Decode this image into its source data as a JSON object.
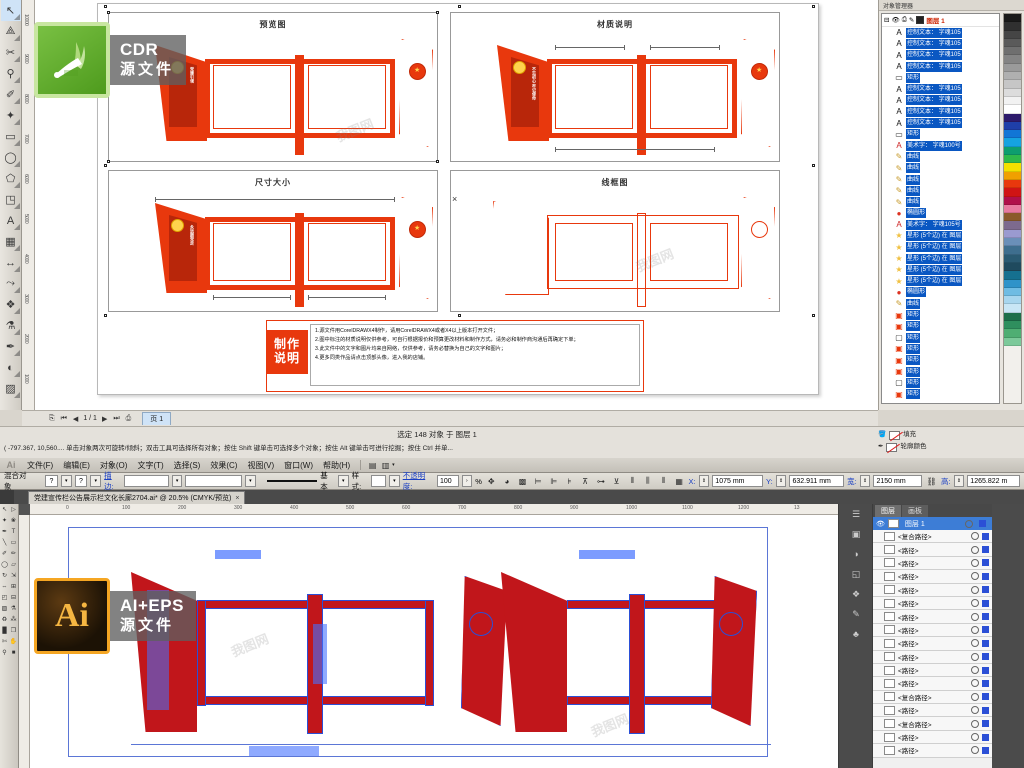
{
  "overlays": [
    {
      "id": "cdr",
      "icon": "coreldraw-icon",
      "line1": "CDR",
      "line2": "源文件"
    },
    {
      "id": "ai",
      "icon": "illustrator-icon",
      "line1": "AI+EPS",
      "line2": "源文件"
    }
  ],
  "watermark": {
    "text": "我图网"
  },
  "cdr": {
    "toolbox": [
      {
        "name": "pick-tool",
        "glyph": "↖"
      },
      {
        "name": "shape-tool",
        "glyph": "⟁"
      },
      {
        "name": "crop-tool",
        "glyph": "✂"
      },
      {
        "name": "zoom-tool",
        "glyph": "⚲"
      },
      {
        "name": "freehand-tool",
        "glyph": "✐"
      },
      {
        "name": "smart-fill-tool",
        "glyph": "✦"
      },
      {
        "name": "rectangle-tool",
        "glyph": "▭"
      },
      {
        "name": "ellipse-tool",
        "glyph": "◯"
      },
      {
        "name": "polygon-tool",
        "glyph": "⬠"
      },
      {
        "name": "basic-shapes-tool",
        "glyph": "◳"
      },
      {
        "name": "text-tool",
        "glyph": "A"
      },
      {
        "name": "table-tool",
        "glyph": "▦"
      },
      {
        "name": "dimension-tool",
        "glyph": "↔"
      },
      {
        "name": "connector-tool",
        "glyph": "⤳"
      },
      {
        "name": "blend-tool",
        "glyph": "❖"
      },
      {
        "name": "color-eyedropper-tool",
        "glyph": "⚗"
      },
      {
        "name": "outline-tool",
        "glyph": "✒"
      },
      {
        "name": "fill-tool",
        "glyph": "◐"
      },
      {
        "name": "interactive-fill-tool",
        "glyph": "▨"
      }
    ],
    "ruler_v": [
      "10000",
      "9000",
      "8000",
      "7000",
      "6000",
      "5000",
      "4000",
      "3000",
      "2000",
      "1000"
    ],
    "panels": [
      {
        "name": "preview-panel",
        "title": "预览图"
      },
      {
        "name": "material-panel",
        "title": "材质说明"
      },
      {
        "name": "size-panel",
        "title": "尺寸大小"
      },
      {
        "name": "wireframe-panel",
        "title": "线框图"
      }
    ],
    "board_vtexts": [
      "党建引领",
      "不忘初心 牢记使命",
      "永远跟党走"
    ],
    "instructions": {
      "badge_line1": "制作",
      "badge_line2": "说明",
      "items": [
        "1.源文件用CorelDRAWX4制作，请用CorelDRAWX4或者X4以上版本打开文件；",
        "2.图中标注的材质说明仅供参考，可自行根据报价和预算更改材料和制作方式，请务必和制作商沟通后再确定下单；",
        "3.此文件中的文字和图片均来自网络，仅供参考，请务必替换为自己的文字和图片；",
        "4.更多同类作品请点击顶部头像，进入我的店铺。"
      ]
    },
    "docker": {
      "tabs": [
        "对象管理器"
      ],
      "layer_name": "图层 1",
      "rows": [
        {
          "icon": "text-icon",
          "label": "控制文本： 字魂105"
        },
        {
          "icon": "text-icon",
          "label": "控制文本： 字魂105"
        },
        {
          "icon": "text-icon",
          "label": "控制文本： 字魂105"
        },
        {
          "icon": "text-icon",
          "label": "控制文本： 字魂105"
        },
        {
          "icon": "rect-icon",
          "label": "矩形"
        },
        {
          "icon": "text-icon",
          "label": "控制文本： 字魂105"
        },
        {
          "icon": "text-icon",
          "label": "控制文本： 字魂105"
        },
        {
          "icon": "text-icon",
          "label": "控制文本： 字魂105"
        },
        {
          "icon": "text-icon",
          "label": "控制文本： 字魂105"
        },
        {
          "icon": "rect-icon",
          "label": "矩形"
        },
        {
          "icon": "artistic-text-icon",
          "label": "美术字： 字魂100号"
        },
        {
          "icon": "curve-icon",
          "label": "曲线"
        },
        {
          "icon": "curve-icon",
          "label": "曲线"
        },
        {
          "icon": "curve-icon",
          "label": "曲线"
        },
        {
          "icon": "curve-icon",
          "label": "曲线"
        },
        {
          "icon": "curve-icon",
          "label": "曲线"
        },
        {
          "icon": "ellipse-icon",
          "label": "椭圆形"
        },
        {
          "icon": "artistic-text-icon",
          "label": "美术字： 字魂105号"
        },
        {
          "icon": "star-icon",
          "label": "星形 (5个边) 在 图层"
        },
        {
          "icon": "star-icon",
          "label": "星形 (5个边) 在 图层"
        },
        {
          "icon": "star-icon",
          "label": "星形 (5个边) 在 图层"
        },
        {
          "icon": "star-icon",
          "label": "星形 (5个边) 在 图层"
        },
        {
          "icon": "star-icon",
          "label": "星形 (5个边) 在 图层"
        },
        {
          "icon": "ellipse-icon",
          "label": "椭圆形"
        },
        {
          "icon": "curve-icon",
          "label": "曲线"
        },
        {
          "icon": "rect-red-icon",
          "label": "矩形"
        },
        {
          "icon": "rect-red-icon",
          "label": "矩形"
        },
        {
          "icon": "rect-white-icon",
          "label": "矩形"
        },
        {
          "icon": "rect-red-icon",
          "label": "矩形"
        },
        {
          "icon": "rect-red-icon",
          "label": "矩形"
        },
        {
          "icon": "rect-red-icon",
          "label": "矩形"
        },
        {
          "icon": "rect-white-icon",
          "label": "矩形"
        },
        {
          "icon": "rect-red-icon",
          "label": "矩形"
        }
      ]
    },
    "palette_colors": [
      "#1a1a1a",
      "#303030",
      "#454545",
      "#5a5a5a",
      "#6f6f6f",
      "#848484",
      "#9a9a9a",
      "#b0b0b0",
      "#c6c6c6",
      "#dcdcdc",
      "#f2f2f2",
      "#ffffff",
      "#2d1b6b",
      "#1f3fa8",
      "#1176d6",
      "#15a3e0",
      "#0e9e6e",
      "#2fb84b",
      "#f3e000",
      "#f0a000",
      "#e8380d",
      "#d01414",
      "#b0104a",
      "#e87aa0",
      "#8b5a2b",
      "#7d6a8e",
      "#9a9ad0",
      "#6a8fb8",
      "#3e6e8e",
      "#2a5a72",
      "#1f4a5e",
      "#15708f",
      "#2f93c9",
      "#6fbce3",
      "#a8d6ee",
      "#c9e6f5",
      "#1e6f4a",
      "#2f8f5e",
      "#4fae73",
      "#7cc99a"
    ],
    "pagenav": {
      "counter": "1 / 1",
      "tab": "页 1",
      "first": "⏮",
      "prev": "◀",
      "next": "▶",
      "last": "⏭"
    },
    "status": {
      "selection": "选定 148 对象 于 图层 1",
      "hint": "( -797.367, 10,560....   单击对象两次可旋转/倾斜；双击工具可选择所有对象；按住 Shift 键单击可选择多个对象；按住 Alt 键单击可进行挖掘；按住 Ctrl 并单...",
      "fill_label": "填充",
      "outline_label": "轮廓颜色"
    }
  },
  "ai": {
    "menu": [
      "文件(F)",
      "编辑(E)",
      "对象(O)",
      "文字(T)",
      "选择(S)",
      "效果(C)",
      "视图(V)",
      "窗口(W)",
      "帮助(H)"
    ],
    "control": {
      "object_type": "混合对象",
      "q1": "?",
      "q2": "?",
      "stroke_label": "描边:",
      "stroke_weight": "",
      "profile": "",
      "brush_label": "基本",
      "style_label": "样式:",
      "opacity_label": "不透明度:",
      "opacity_value": "100",
      "opacity_unit": "%",
      "x_label": "X:",
      "x_value": "1075 mm",
      "y_label": "Y:",
      "y_value": "632.911 mm",
      "w_label": "宽:",
      "w_value": "2150 mm",
      "h_label": "高:",
      "h_value": "1265.822 m"
    },
    "tab": {
      "title": "党建宣传栏公告展示栏文化长廊2704.ai* @ 20.5% (CMYK/预览)",
      "close": "×"
    },
    "ruler_h": [
      "0",
      "100",
      "200",
      "300",
      "400",
      "500",
      "600",
      "700",
      "800",
      "900",
      "1000",
      "1100",
      "1200",
      "13"
    ],
    "panels": {
      "tabs": [
        "图层",
        "画板"
      ],
      "active_tab": "图层",
      "layer_name": "图层 1",
      "rows": [
        {
          "label": "<复合路径>"
        },
        {
          "label": "<路径>"
        },
        {
          "label": "<路径>"
        },
        {
          "label": "<路径>"
        },
        {
          "label": "<路径>"
        },
        {
          "label": "<路径>"
        },
        {
          "label": "<路径>"
        },
        {
          "label": "<路径>"
        },
        {
          "label": "<路径>"
        },
        {
          "label": "<路径>"
        },
        {
          "label": "<路径>"
        },
        {
          "label": "<路径>"
        },
        {
          "label": "<复合路径>"
        },
        {
          "label": "<路径>"
        },
        {
          "label": "<复合路径>"
        },
        {
          "label": "<路径>"
        },
        {
          "label": "<路径>"
        }
      ],
      "dock_icons": [
        {
          "name": "color-panel-icon",
          "glyph": "☰"
        },
        {
          "name": "swatches-panel-icon",
          "glyph": "▣"
        },
        {
          "name": "gradient-panel-icon",
          "glyph": "◑"
        },
        {
          "name": "transparency-panel-icon",
          "glyph": "◱"
        },
        {
          "name": "symbols-panel-icon",
          "glyph": "❖"
        },
        {
          "name": "brushes-panel-icon",
          "glyph": "✎"
        },
        {
          "name": "graphic-styles-panel-icon",
          "glyph": "♣"
        }
      ]
    },
    "toolbox": [
      {
        "name": "selection-tool",
        "glyph": "↖"
      },
      {
        "name": "direct-selection-tool",
        "glyph": "▷"
      },
      {
        "name": "magic-wand-tool",
        "glyph": "✦"
      },
      {
        "name": "lasso-tool",
        "glyph": "❀"
      },
      {
        "name": "pen-tool",
        "glyph": "✒"
      },
      {
        "name": "type-tool",
        "glyph": "T"
      },
      {
        "name": "line-tool",
        "glyph": "╲"
      },
      {
        "name": "rectangle-tool",
        "glyph": "▭"
      },
      {
        "name": "paintbrush-tool",
        "glyph": "✐"
      },
      {
        "name": "pencil-tool",
        "glyph": "✏"
      },
      {
        "name": "blob-brush-tool",
        "glyph": "◯"
      },
      {
        "name": "eraser-tool",
        "glyph": "▱"
      },
      {
        "name": "rotate-tool",
        "glyph": "↻"
      },
      {
        "name": "scale-tool",
        "glyph": "⇲"
      },
      {
        "name": "width-tool",
        "glyph": "⇔"
      },
      {
        "name": "shape-builder-tool",
        "glyph": "⊞"
      },
      {
        "name": "perspective-grid-tool",
        "glyph": "◰"
      },
      {
        "name": "mesh-tool",
        "glyph": "⊟"
      },
      {
        "name": "gradient-tool",
        "glyph": "▨"
      },
      {
        "name": "eyedropper-tool",
        "glyph": "⚗"
      },
      {
        "name": "blend-tool",
        "glyph": "♻"
      },
      {
        "name": "symbol-sprayer-tool",
        "glyph": "⁂"
      },
      {
        "name": "column-graph-tool",
        "glyph": "█"
      },
      {
        "name": "artboard-tool",
        "glyph": "❐"
      },
      {
        "name": "slice-tool",
        "glyph": "✄"
      },
      {
        "name": "hand-tool",
        "glyph": "✋"
      },
      {
        "name": "zoom-tool",
        "glyph": "⚲"
      },
      {
        "name": "fill-stroke-swatch",
        "glyph": "■"
      }
    ]
  }
}
